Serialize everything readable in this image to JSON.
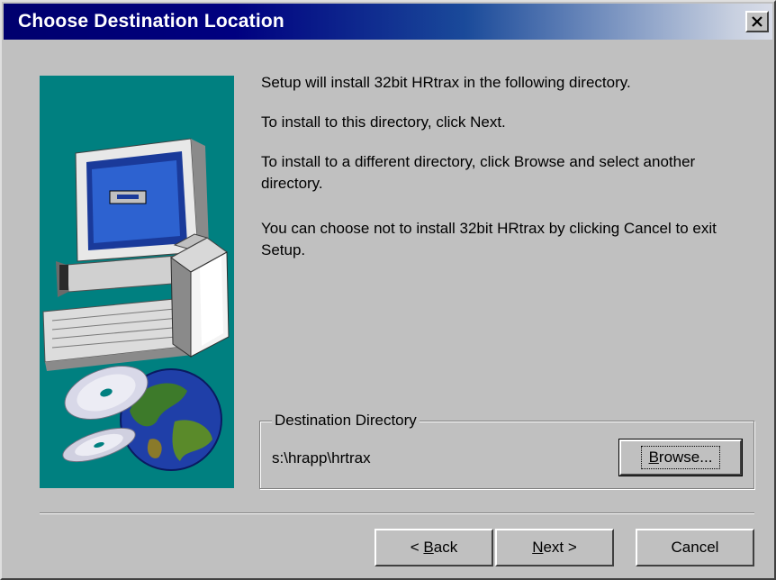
{
  "window": {
    "title": "Choose Destination Location",
    "close_glyph": "×",
    "colors": {
      "titlebar_start": "#000080",
      "titlebar_end": "#d8dce8",
      "face": "#c0c0c0",
      "illustration_bg": "#008080"
    }
  },
  "illustration": {
    "icons": [
      "computer-icon",
      "software-box-icon",
      "cd-disc-icon",
      "globe-icon"
    ]
  },
  "body": {
    "paragraphs": [
      "Setup will install 32bit HRtrax in the following directory.",
      "To install to this directory, click Next.",
      "To install to a different directory, click Browse and select another directory.",
      "You can choose not to install 32bit HRtrax by clicking Cancel to exit Setup."
    ]
  },
  "destination": {
    "group_label": "Destination Directory",
    "path": "s:\\hrapp\\hrtrax",
    "browse_label_accel": "B",
    "browse_label_rest": "rowse..."
  },
  "buttons": {
    "back_prefix": "< ",
    "back_accel": "B",
    "back_rest": "ack",
    "next_accel": "N",
    "next_rest": "ext >",
    "cancel_label": "Cancel"
  }
}
